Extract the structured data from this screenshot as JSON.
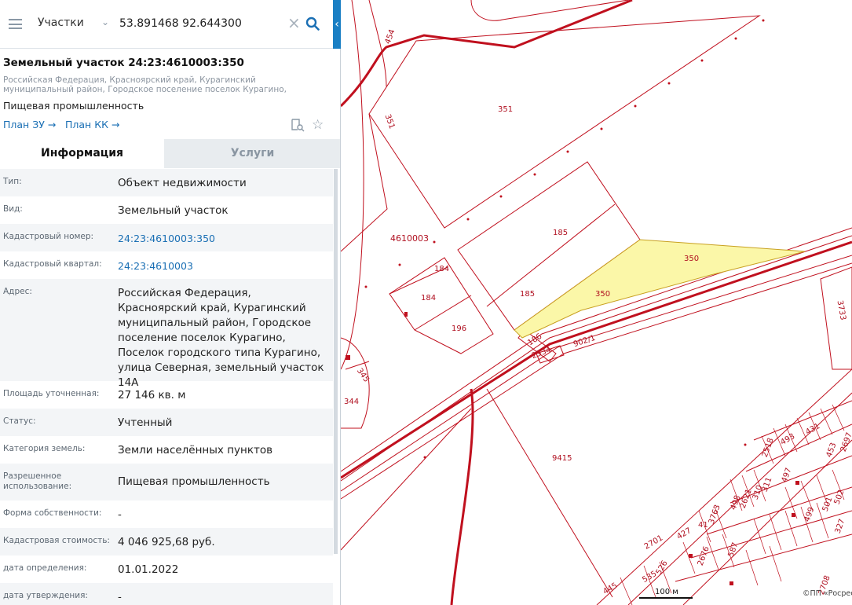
{
  "search": {
    "layer": "Участки",
    "query": "53.891468 92.644300"
  },
  "parcel": {
    "title": "Земельный участок 24:23:4610003:350",
    "address_short": "Российская Федерация, Красноярский край, Курагинский муниципальный район, Городское поселение поселок Курагино, Поселок городского типа…",
    "use": "Пищевая промышленность",
    "plan_zu": "План ЗУ →",
    "plan_kk": "План КК →"
  },
  "tabs": {
    "info": "Информация",
    "services": "Услуги"
  },
  "rows": [
    {
      "key": "Тип:",
      "value": "Объект недвижимости"
    },
    {
      "key": "Вид:",
      "value": "Земельный участок"
    },
    {
      "key": "Кадастровый номер:",
      "value": "24:23:4610003:350"
    },
    {
      "key": "Кадастровый квартал:",
      "value": "24:23:4610003"
    },
    {
      "key": "Адрес:",
      "value": "Российская Федерация, Красноярский край, Курагинский муниципальный район, Городское поселение поселок Курагино, Поселок городского типа Курагино, улица Северная, земельный участок 14А"
    },
    {
      "key": "Площадь уточненная:",
      "value": "27 146 кв. м"
    },
    {
      "key": "Статус:",
      "value": "Учтенный"
    },
    {
      "key": "Категория земель:",
      "value": "Земли населённых пунктов"
    },
    {
      "key": "Разрешенное использование:",
      "value": "Пищевая промышленность"
    },
    {
      "key": "Форма собственности:",
      "value": "-"
    },
    {
      "key": "Кадастровая стоимость:",
      "value": "4 046 925,68 руб."
    },
    {
      "key": "дата определения:",
      "value": "01.01.2022"
    },
    {
      "key": "дата утверждения:",
      "value": "-"
    }
  ],
  "map": {
    "labels": {
      "l454": "454",
      "l351a": "351",
      "l351b": "351",
      "l4610003": "4610003",
      "l185a": "185",
      "l185b": "185",
      "l184a": "184",
      "l184b": "184",
      "l196": "196",
      "l350a": "350",
      "l350b": "350",
      "l186": "186",
      "l2534": "2534",
      "l902": "902/1",
      "l345": "345",
      "l344": "344",
      "l9415": "9415",
      "l3733": "3733",
      "l431": "431",
      "l493": "493",
      "l2518": "2518",
      "l497": "497",
      "l453": "453",
      "l2697": "2697",
      "l311": "311",
      "l310": "310",
      "l2621": "2621",
      "l498": "498",
      "l499": "499",
      "l501": "501",
      "l502": "502",
      "l3763": "3763",
      "l41": "41",
      "l427": "427",
      "l2701": "2701",
      "l2676": "2676",
      "l587": "587",
      "l526": "526",
      "l535": "535",
      "l445": "445",
      "l327": "327",
      "l2708": "2708"
    },
    "scale": "100 м",
    "copyright": "©ПП «Росреестр»",
    "highlight_color": "#fbf7a8",
    "line_color": "#c0101e"
  }
}
